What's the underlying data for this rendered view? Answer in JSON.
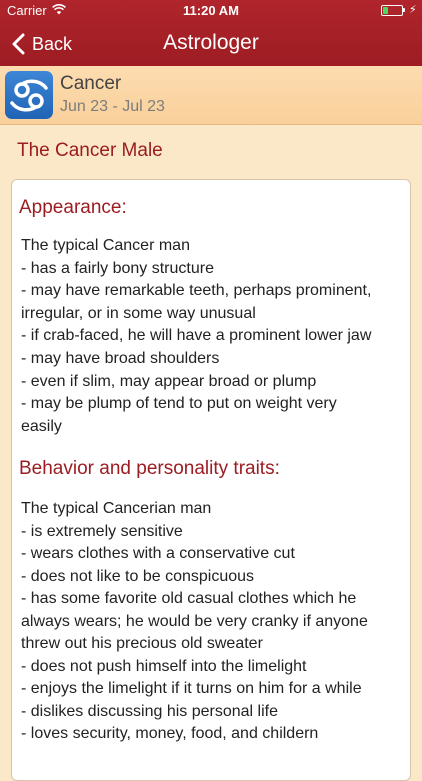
{
  "status": {
    "carrier": "Carrier",
    "time": "11:20 AM",
    "battery_level": 0.2,
    "battery_color": "#4cd964"
  },
  "nav": {
    "back_label": "Back",
    "title": "Astrologer"
  },
  "sign": {
    "name": "Cancer",
    "dates": "Jun 23 - Jul 23",
    "icon": "cancer-zodiac-icon"
  },
  "section_title": "The Cancer Male",
  "appearance": {
    "heading": "Appearance:",
    "lines": [
      "The typical Cancer man",
      "- has a fairly bony structure",
      "- may have remarkable teeth, perhaps prominent,",
      "irregular, or in some way unusual",
      "- if crab-faced, he will have a prominent lower jaw",
      "- may have broad shoulders",
      "- even if slim, may appear broad or plump",
      "- may be plump of tend to put on weight very",
      "easily"
    ]
  },
  "behavior": {
    "heading": "Behavior and personality traits:",
    "lines": [
      "The typical Cancerian man",
      "- is extremely sensitive",
      "- wears clothes with a conservative cut",
      "- does not like to be conspicuous",
      "- has some favorite old casual clothes which he",
      "always wears; he would be very cranky if anyone",
      "threw out his precious old sweater",
      "- does not push himself into the limelight",
      "- enjoys the limelight if it turns on him for a while",
      "- dislikes discussing his personal life",
      "- loves security, money, food, and childern"
    ]
  },
  "colors": {
    "accent": "#9b1d22",
    "nav_bg": "#a8222a",
    "background": "#fbe8c8"
  }
}
